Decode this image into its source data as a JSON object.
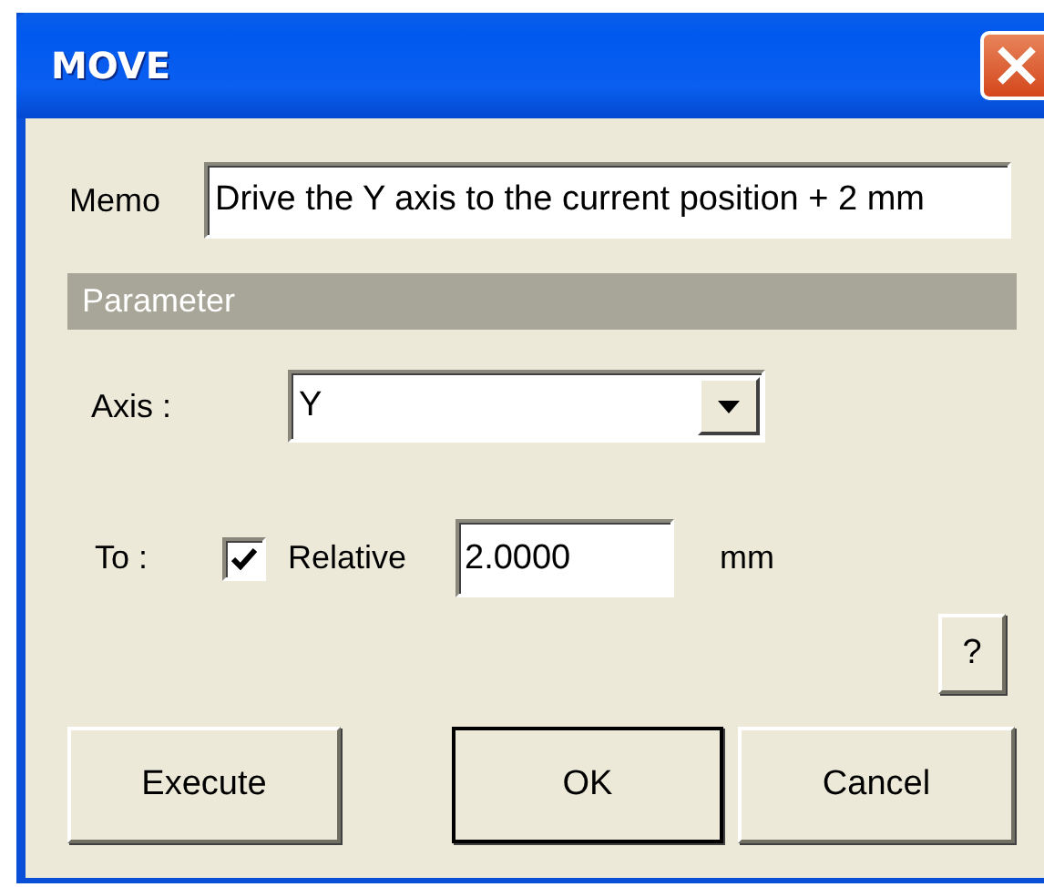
{
  "window": {
    "title": "MOVE"
  },
  "memo": {
    "label": "Memo",
    "value": "Drive the Y axis to the current position + 2 mm"
  },
  "section": {
    "title": "Parameter"
  },
  "axis": {
    "label": "Axis :",
    "value": "Y"
  },
  "target": {
    "label": "To :",
    "relative": {
      "label": "Relative",
      "checked": true
    },
    "value": "2.0000",
    "unit": "mm"
  },
  "help_button": "?",
  "buttons": [
    {
      "label": "Execute",
      "default": false
    },
    {
      "label": "OK",
      "default": true
    },
    {
      "label": "Cancel",
      "default": false
    }
  ]
}
